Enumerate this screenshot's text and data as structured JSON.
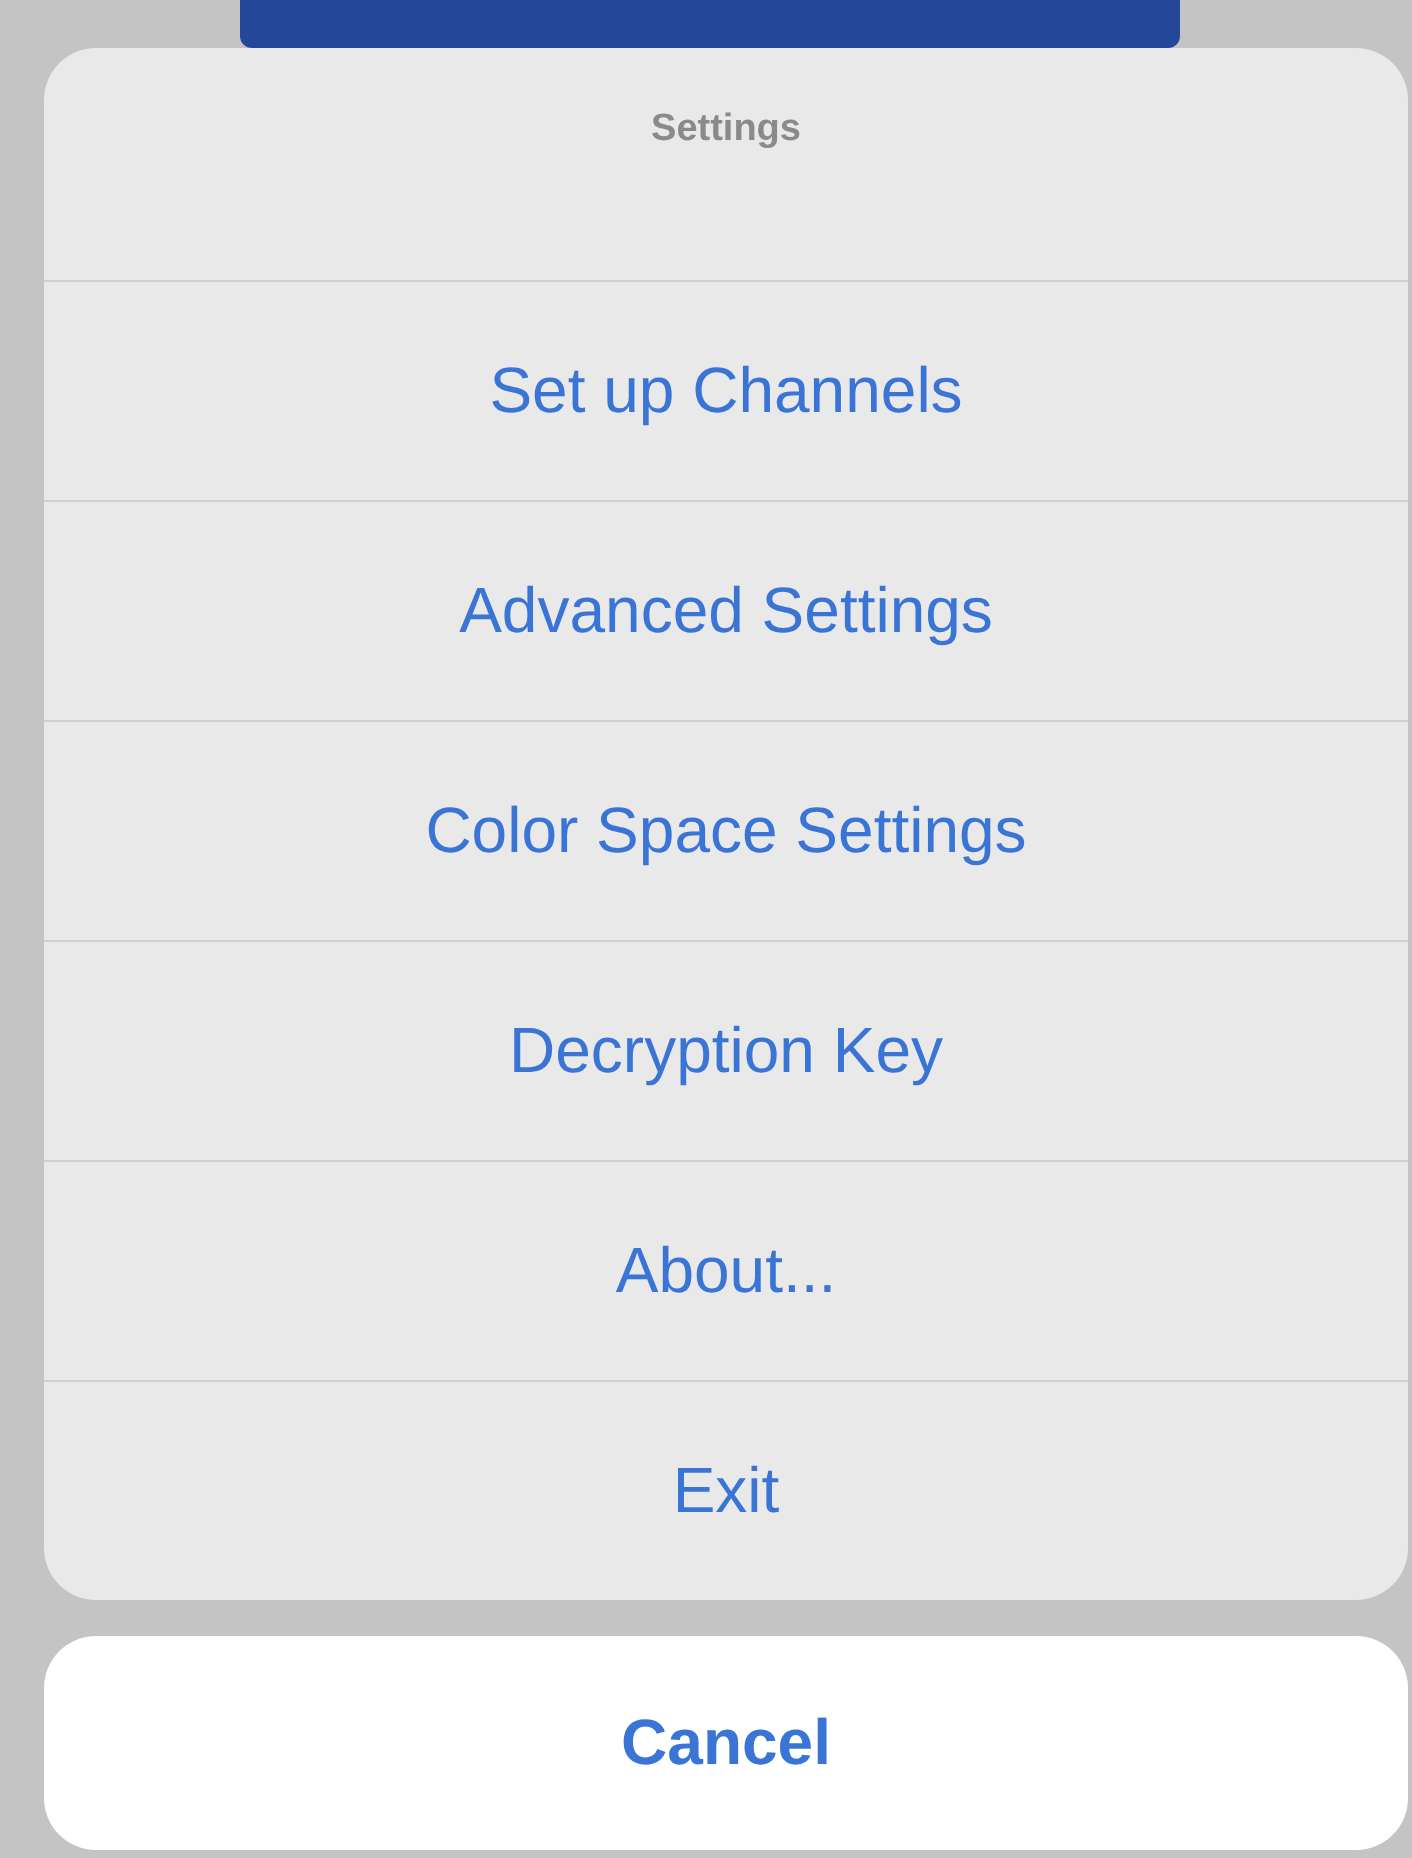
{
  "sheet": {
    "title": "Settings",
    "actions": [
      {
        "label": "Set up Channels"
      },
      {
        "label": "Advanced Settings"
      },
      {
        "label": "Color Space Settings"
      },
      {
        "label": "Decryption Key"
      },
      {
        "label": "About..."
      },
      {
        "label": "Exit"
      }
    ]
  },
  "cancel": {
    "label": "Cancel"
  }
}
